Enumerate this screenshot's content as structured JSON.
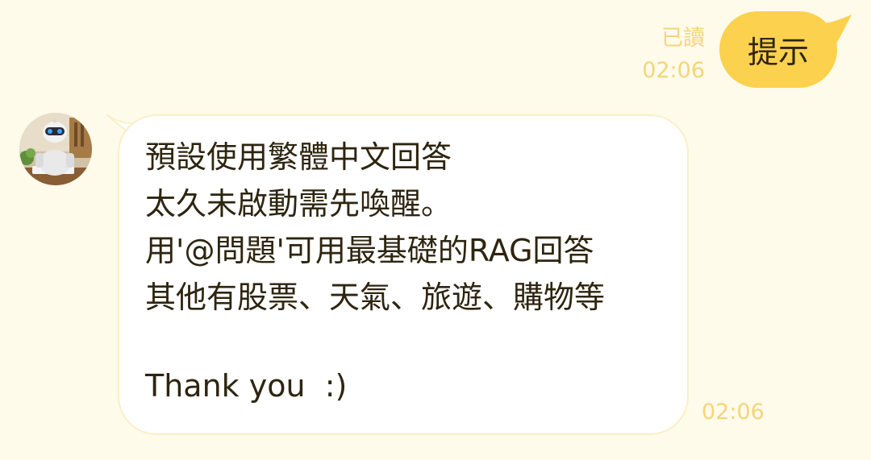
{
  "outgoing": {
    "read_label": "已讀",
    "time": "02:06",
    "text": "提示"
  },
  "incoming": {
    "lines": [
      "預設使用繁體中文回答",
      "太久未啟動需先喚醒。",
      "用'@問題'可用最基礎的RAG回答",
      "其他有股票、天氣、旅遊、購物等"
    ],
    "closing": "Thank you  :)",
    "time": "02:06"
  },
  "colors": {
    "background": "#fffbea",
    "outgoing_bubble": "#fbd14e",
    "meta_text": "#f3d57a",
    "body_text": "#2e2510"
  }
}
